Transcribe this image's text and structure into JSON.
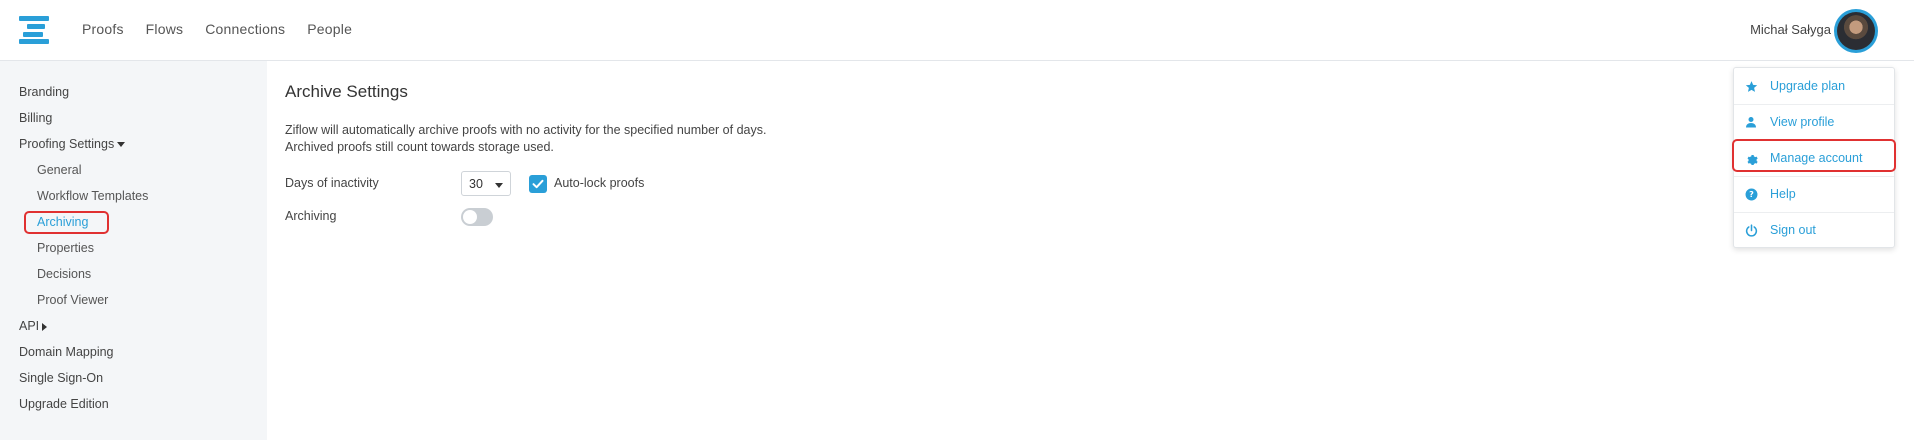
{
  "nav": {
    "items": [
      {
        "label": "Proofs"
      },
      {
        "label": "Flows"
      },
      {
        "label": "Connections"
      },
      {
        "label": "People"
      }
    ]
  },
  "user": {
    "name": "Michał Sałyga"
  },
  "sidebar": {
    "branding": "Branding",
    "billing": "Billing",
    "proofing_settings": "Proofing Settings",
    "general": "General",
    "workflow_templates": "Workflow Templates",
    "archiving": "Archiving",
    "properties": "Properties",
    "decisions": "Decisions",
    "proof_viewer": "Proof Viewer",
    "api": "API",
    "domain_mapping": "Domain Mapping",
    "single_sign_on": "Single Sign-On",
    "upgrade_edition": "Upgrade Edition"
  },
  "main": {
    "title": "Archive Settings",
    "desc_line1": "Ziflow will automatically archive proofs with no activity for the specified number of days.",
    "desc_line2": "Archived proofs still count towards storage used.",
    "days_label": "Days of inactivity",
    "days_value": "30",
    "autolock_label": "Auto-lock proofs",
    "autolock_checked": true,
    "archiving_label": "Archiving",
    "archiving_enabled": false
  },
  "menu": {
    "upgrade_plan": "Upgrade plan",
    "view_profile": "View profile",
    "manage_account": "Manage account",
    "help": "Help",
    "sign_out": "Sign out"
  },
  "colors": {
    "accent": "#2a9fd8",
    "highlight": "#e03131",
    "sidebar_bg": "#f4f6f8"
  }
}
